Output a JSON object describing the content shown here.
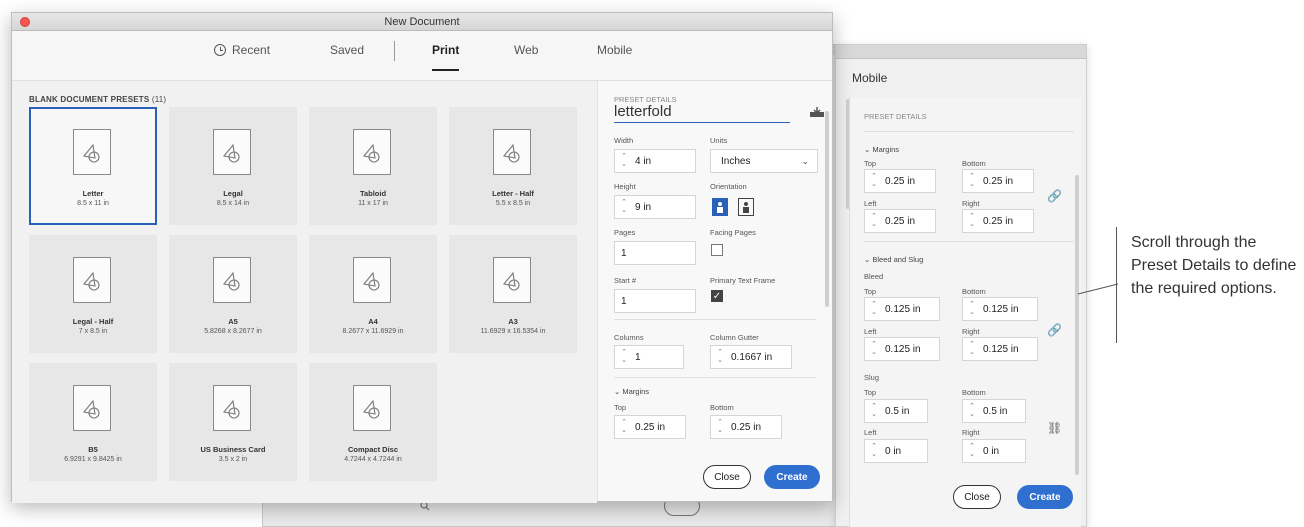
{
  "main_window": {
    "title": "New Document",
    "tabs": [
      {
        "label": "Recent",
        "icon": "clock-icon"
      },
      {
        "label": "Saved"
      },
      {
        "label": "Print",
        "active": true
      },
      {
        "label": "Web"
      },
      {
        "label": "Mobile"
      }
    ],
    "presets_heading": "BLANK DOCUMENT PRESETS",
    "presets_count": "(11)",
    "presets": [
      {
        "name": "Letter",
        "dims": "8.5 x 11 in",
        "selected": true
      },
      {
        "name": "Legal",
        "dims": "8.5 x 14 in"
      },
      {
        "name": "Tabloid",
        "dims": "11 x 17 in"
      },
      {
        "name": "Letter - Half",
        "dims": "5.5 x 8.5 in"
      },
      {
        "name": "Legal - Half",
        "dims": "7 x 8.5 in"
      },
      {
        "name": "A5",
        "dims": "5.8268 x 8.2677 in"
      },
      {
        "name": "A4",
        "dims": "8.2677 x 11.6929 in"
      },
      {
        "name": "A3",
        "dims": "11.6929 x 16.5354 in"
      },
      {
        "name": "B5",
        "dims": "6.9291 x 9.8425 in"
      },
      {
        "name": "US Business Card",
        "dims": "3.5 x 2 in"
      },
      {
        "name": "Compact Disc",
        "dims": "4.7244 x 4.7244 in"
      }
    ],
    "details": {
      "heading": "PRESET DETAILS",
      "doc_name": "letterfold",
      "width_label": "Width",
      "width_value": "4 in",
      "units_label": "Units",
      "units_value": "Inches",
      "height_label": "Height",
      "height_value": "9 in",
      "orientation_label": "Orientation",
      "pages_label": "Pages",
      "pages_value": "1",
      "facing_label": "Facing Pages",
      "facing_checked": false,
      "start_label": "Start #",
      "start_value": "1",
      "primary_label": "Primary Text Frame",
      "primary_checked": true,
      "columns_label": "Columns",
      "columns_value": "1",
      "gutter_label": "Column Gutter",
      "gutter_value": "0.1667 in",
      "margins_label": "Margins",
      "top_label": "Top",
      "top_value": "0.25 in",
      "bottom_label": "Bottom",
      "bottom_value": "0.25 in"
    },
    "close_label": "Close",
    "create_label": "Create"
  },
  "second_window": {
    "tab_label": "Mobile",
    "heading": "PRESET DETAILS",
    "margins_label": "Margins",
    "top_label": "Top",
    "top_value": "0.25 in",
    "bottom_label": "Bottom",
    "bottom_value": "0.25 in",
    "left_label": "Left",
    "left_value": "0.25 in",
    "right_label": "Right",
    "right_value": "0.25 in",
    "bleed_slug_label": "Bleed and Slug",
    "bleed_label": "Bleed",
    "bleed_top_label": "Top",
    "bleed_top_value": "0.125 in",
    "bleed_bottom_label": "Bottom",
    "bleed_bottom_value": "0.125 in",
    "bleed_left_label": "Left",
    "bleed_left_value": "0.125 in",
    "bleed_right_label": "Right",
    "bleed_right_value": "0.125 in",
    "slug_label": "Slug",
    "slug_top_label": "Top",
    "slug_top_value": "0.5 in",
    "slug_bottom_label": "Bottom",
    "slug_bottom_value": "0.5 in",
    "slug_left_label": "Left",
    "slug_left_value": "0 in",
    "slug_right_label": "Right",
    "slug_right_value": "0 in",
    "close_label": "Close",
    "create_label": "Create"
  },
  "callout": {
    "text": "Scroll through the Preset Details to define the required options."
  },
  "colors": {
    "accent": "#2e6fd0",
    "selection_border": "#2a61b8",
    "close_dot": "#f2564c"
  }
}
